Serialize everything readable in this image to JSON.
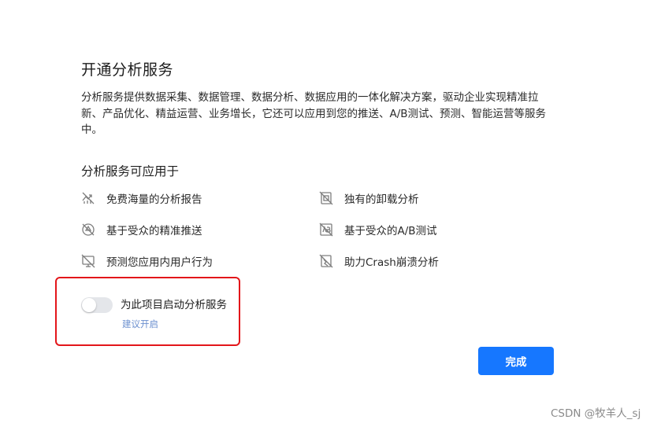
{
  "dialog": {
    "title": "开通分析服务",
    "description": "分析服务提供数据采集、数据管理、数据分析、数据应用的一体化解决方案，驱动企业实现精准拉新、产品优化、精益运营、业务增长，它还可以应用到您的推送、A/B测试、预测、智能运营等服务中。",
    "features_title": "分析服务可应用于",
    "features": [
      {
        "label": "免费海量的分析报告",
        "icon": "analytics-report-icon"
      },
      {
        "label": "独有的卸载分析",
        "icon": "uninstall-analysis-icon"
      },
      {
        "label": "基于受众的精准推送",
        "icon": "targeted-push-icon"
      },
      {
        "label": "基于受众的A/B测试",
        "icon": "ab-test-icon"
      },
      {
        "label": "预测您应用内用户行为",
        "icon": "prediction-icon"
      },
      {
        "label": "助力Crash崩溃分析",
        "icon": "crash-analysis-icon"
      }
    ],
    "toggle": {
      "label": "为此项目启动分析服务",
      "hint": "建议开启",
      "enabled": false
    },
    "done_label": "完成"
  },
  "colors": {
    "primary": "#1677ff",
    "highlight_border": "#e3161a",
    "hint": "#6b8fcf",
    "toggle_off": "#e4e6ea"
  },
  "watermark": "CSDN @牧羊人_sj"
}
